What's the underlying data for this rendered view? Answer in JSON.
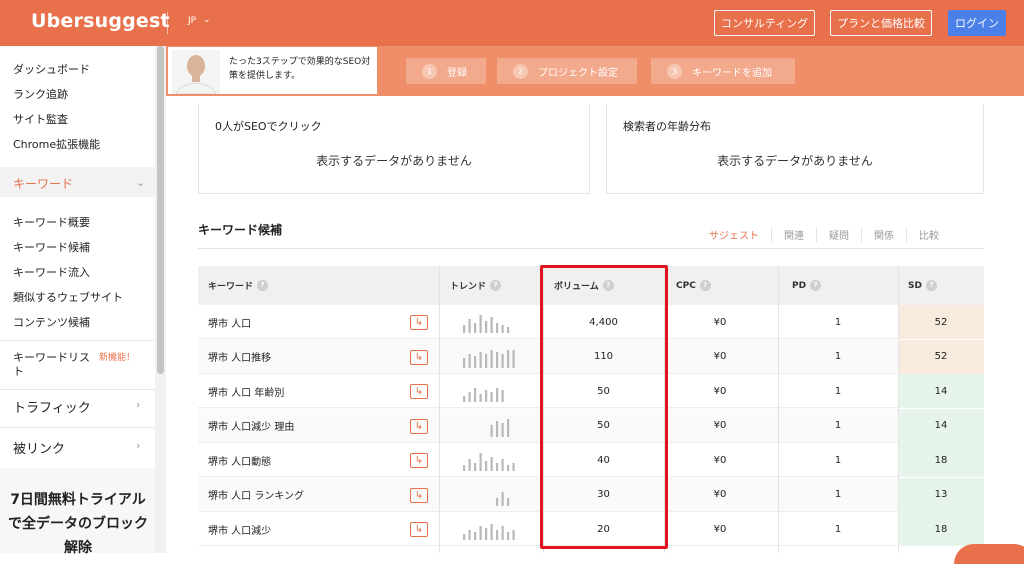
{
  "header": {
    "brand": "Ubersuggest",
    "lang": "JP",
    "consult": "コンサルティング",
    "plans": "プランと価格比較",
    "login": "ログイン"
  },
  "promo": {
    "text": "たった3ステップで効果的なSEO対策を提供します。",
    "steps": [
      {
        "num": "1",
        "label": "登録"
      },
      {
        "num": "2",
        "label": "プロジェクト設定"
      },
      {
        "num": "3",
        "label": "キーワードを追加"
      }
    ]
  },
  "sidebar": {
    "top_items": [
      "ダッシュボード",
      "ランク追跡",
      "サイト監査",
      "Chrome拡張機能"
    ],
    "keyword_section": "キーワード",
    "keyword_items": [
      "キーワード概要",
      "キーワード候補",
      "キーワード流入",
      "類似するウェブサイト",
      "コンテンツ候補"
    ],
    "keyword_list": "キーワードリスト",
    "new_badge": "新機能！",
    "traffic": "トラフィック",
    "backlinks": "被リンク",
    "trial": "7日間無料トライアルで全データのブロック解除"
  },
  "cards": {
    "clicks_title": "0人がSEOでクリック",
    "age_title": "検索者の年齢分布",
    "empty": "表示するデータがありません"
  },
  "suggestions": {
    "heading": "キーワード候補",
    "tabs": [
      "サジェスト",
      "関連",
      "疑問",
      "関係",
      "比較"
    ],
    "columns": {
      "keyword": "キーワード",
      "trend": "トレンド",
      "volume": "ボリューム",
      "cpc": "CPC",
      "pd": "PD",
      "sd": "SD"
    },
    "rows": [
      {
        "keyword": "堺市 人口",
        "volume": "4,400",
        "cpc": "¥0",
        "pd": "1",
        "sd": "52",
        "sd_color": "#f7ebdd",
        "trend": [
          4,
          7,
          5,
          9,
          6,
          8,
          5,
          4,
          3
        ]
      },
      {
        "keyword": "堺市 人口推移",
        "volume": "110",
        "cpc": "¥0",
        "pd": "1",
        "sd": "52",
        "sd_color": "#f7ebdd",
        "trend": [
          5,
          7,
          6,
          8,
          7,
          9,
          8,
          7,
          9,
          9
        ]
      },
      {
        "keyword": "堺市 人口 年齢別",
        "volume": "50",
        "cpc": "¥0",
        "pd": "1",
        "sd": "14",
        "sd_color": "#e6f4ec",
        "trend": [
          3,
          5,
          7,
          4,
          6,
          5,
          7,
          6
        ]
      },
      {
        "keyword": "堺市 人口減少 理由",
        "volume": "50",
        "cpc": "¥0",
        "pd": "1",
        "sd": "14",
        "sd_color": "#e6f4ec",
        "trend": [
          0,
          0,
          0,
          0,
          0,
          6,
          8,
          7,
          9
        ]
      },
      {
        "keyword": "堺市 人口動態",
        "volume": "40",
        "cpc": "¥0",
        "pd": "1",
        "sd": "18",
        "sd_color": "#e6f4ec",
        "trend": [
          3,
          6,
          4,
          9,
          5,
          7,
          4,
          6,
          3,
          4
        ]
      },
      {
        "keyword": "堺市 人口 ランキング",
        "volume": "30",
        "cpc": "¥0",
        "pd": "1",
        "sd": "13",
        "sd_color": "#e6f4ec",
        "trend": [
          0,
          0,
          0,
          0,
          0,
          0,
          4,
          7,
          4
        ]
      },
      {
        "keyword": "堺市 人口減少",
        "volume": "20",
        "cpc": "¥0",
        "pd": "1",
        "sd": "18",
        "sd_color": "#e6f4ec",
        "trend": [
          3,
          5,
          4,
          7,
          6,
          8,
          5,
          7,
          4,
          5
        ]
      }
    ]
  },
  "colors": {
    "brand": "#e8704a",
    "login": "#4a80e8",
    "highlight": "#e0141e"
  }
}
